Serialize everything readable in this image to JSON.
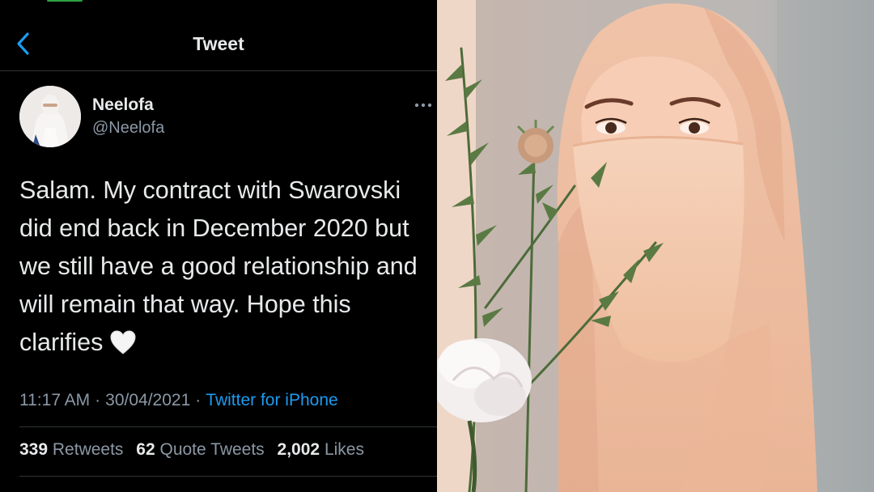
{
  "header": {
    "title": "Tweet",
    "back_icon": "chevron-left-icon"
  },
  "author": {
    "display_name": "Neelofa",
    "handle": "@Neelofa",
    "more_icon": "more-horizontal-icon"
  },
  "tweet": {
    "lines": [
      "Salam. My contract with Swarovski",
      "did end back in December 2020 but",
      "we still have a good relationship and",
      "will remain that way. Hope this",
      "clarifies"
    ],
    "emoji_icon": "white-heart-icon"
  },
  "meta": {
    "time": "11:17 AM",
    "date": "30/04/2021",
    "separator": "·",
    "source": "Twitter for iPhone"
  },
  "stats": {
    "retweets_count": "339",
    "retweets_label": "Retweets",
    "quotes_count": "62",
    "quotes_label": "Quote Tweets",
    "likes_count": "2,002",
    "likes_label": "Likes"
  },
  "colors": {
    "background": "#000000",
    "accent": "#1d9bf0",
    "secondary_text": "#8b98a5",
    "divider": "#2f3336"
  }
}
